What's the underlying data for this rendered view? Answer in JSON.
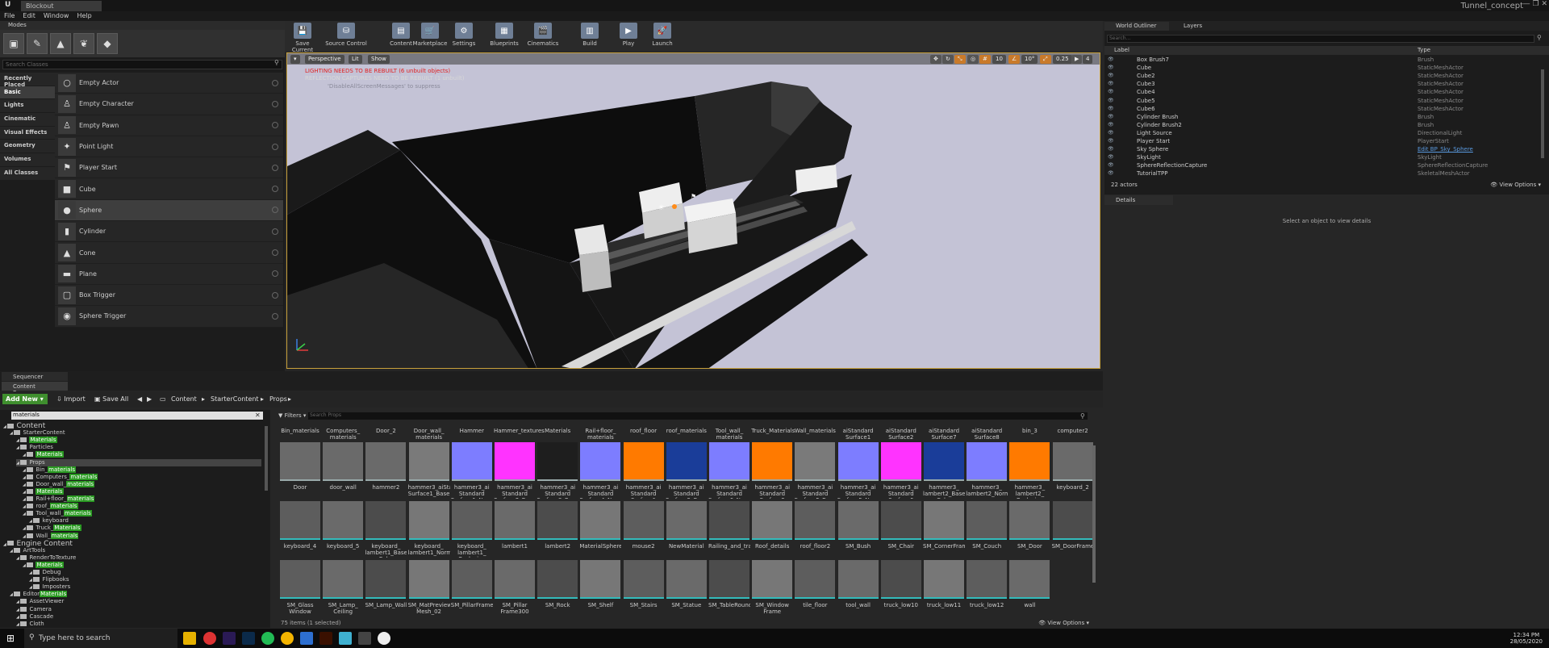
{
  "window": {
    "tab_title": "Blockout",
    "project": "Tunnel_concept",
    "win_controls": "—  ❐  ✕"
  },
  "menu": [
    "File",
    "Edit",
    "Window",
    "Help"
  ],
  "modes": {
    "title": "Modes",
    "search_placeholder": "Search Classes",
    "categories": [
      "Recently Placed",
      "Basic",
      "Lights",
      "Cinematic",
      "Visual Effects",
      "Geometry",
      "Volumes",
      "All Classes"
    ],
    "items": [
      "Empty Actor",
      "Empty Character",
      "Empty Pawn",
      "Point Light",
      "Player Start",
      "Cube",
      "Sphere",
      "Cylinder",
      "Cone",
      "Plane",
      "Box Trigger",
      "Sphere Trigger"
    ]
  },
  "toolbar": [
    "Save Current",
    "Source Control",
    "Content",
    "Marketplace",
    "Settings",
    "Blueprints",
    "Cinematics",
    "Build",
    "Play",
    "Launch"
  ],
  "viewport": {
    "buttons": [
      "Perspective",
      "Lit",
      "Show"
    ],
    "warning1": "LIGHTING NEEDS TO BE REBUILT (6 unbuilt objects)",
    "warning2": "REFLECTION CAPTURES NEED TO BE REBUILT (1 unbuilt)",
    "warning3": "'DisableAllScreenMessages' to suppress",
    "snap_values": [
      "10",
      "10°",
      "0.25",
      "4"
    ]
  },
  "outliner": {
    "tabs": [
      "World Outliner",
      "Layers"
    ],
    "search_placeholder": "Search...",
    "col_label": "Label",
    "col_type": "Type",
    "rows": [
      {
        "label": "Box Brush7",
        "type": "Brush"
      },
      {
        "label": "Cube",
        "type": "StaticMeshActor"
      },
      {
        "label": "Cube2",
        "type": "StaticMeshActor"
      },
      {
        "label": "Cube3",
        "type": "StaticMeshActor"
      },
      {
        "label": "Cube4",
        "type": "StaticMeshActor"
      },
      {
        "label": "Cube5",
        "type": "StaticMeshActor"
      },
      {
        "label": "Cube6",
        "type": "StaticMeshActor"
      },
      {
        "label": "Cylinder Brush",
        "type": "Brush"
      },
      {
        "label": "Cylinder Brush2",
        "type": "Brush"
      },
      {
        "label": "Light Source",
        "type": "DirectionalLight"
      },
      {
        "label": "Player Start",
        "type": "PlayerStart"
      },
      {
        "label": "Sky Sphere",
        "type": "Edit BP_Sky_Sphere"
      },
      {
        "label": "SkyLight",
        "type": "SkyLight"
      },
      {
        "label": "SphereReflectionCapture",
        "type": "SphereReflectionCapture"
      },
      {
        "label": "TutorialTPP",
        "type": "SkeletalMeshActor"
      }
    ],
    "count": "22 actors",
    "view_options": "View Options"
  },
  "details": {
    "tab": "Details",
    "message": "Select an object to view details"
  },
  "bottom_tabs": [
    "Sequencer",
    "Content Browser"
  ],
  "content_browser": {
    "add_new": "Add New",
    "import": "Import",
    "save_all": "Save All",
    "path": [
      "Content",
      "StarterContent",
      "Props"
    ],
    "tree_search": "materials",
    "filters": "Filters",
    "search_placeholder": "Search Props",
    "tree": [
      {
        "label": "Content",
        "hl": "",
        "indent": 0,
        "bold": true
      },
      {
        "label": "StarterContent",
        "hl": "",
        "indent": 1
      },
      {
        "label": "",
        "hl": "Materials",
        "indent": 2
      },
      {
        "label": "Particles",
        "hl": "",
        "indent": 2
      },
      {
        "label": "",
        "hl": "Materials",
        "indent": 3
      },
      {
        "label": "Props",
        "hl": "",
        "indent": 2,
        "sel": true
      },
      {
        "label": "Bin_",
        "hl": "materials",
        "indent": 3
      },
      {
        "label": "Computers_",
        "hl": "materials",
        "indent": 3
      },
      {
        "label": "Door_wall_",
        "hl": "materials",
        "indent": 3
      },
      {
        "label": "",
        "hl": "Materials",
        "indent": 3
      },
      {
        "label": "Rail+floor_",
        "hl": "materials",
        "indent": 3
      },
      {
        "label": "roof_",
        "hl": "materials",
        "indent": 3
      },
      {
        "label": "Tool_wall_",
        "hl": "materials",
        "indent": 3
      },
      {
        "label": "keyboard",
        "hl": "",
        "indent": 4
      },
      {
        "label": "Truck_",
        "hl": "Materials",
        "indent": 3
      },
      {
        "label": "Wall_",
        "hl": "materials",
        "indent": 3
      },
      {
        "label": "Engine Content",
        "hl": "",
        "indent": 0,
        "bold": true
      },
      {
        "label": "ArtTools",
        "hl": "",
        "indent": 1
      },
      {
        "label": "RenderToTexture",
        "hl": "",
        "indent": 2
      },
      {
        "label": "",
        "hl": "Materials",
        "indent": 3
      },
      {
        "label": "Debug",
        "hl": "",
        "indent": 4
      },
      {
        "label": "Flipbooks",
        "hl": "",
        "indent": 4
      },
      {
        "label": "Imposters",
        "hl": "",
        "indent": 4
      },
      {
        "label": "Editor",
        "hl": "Materials",
        "indent": 1
      },
      {
        "label": "AssetViewer",
        "hl": "",
        "indent": 2
      },
      {
        "label": "Camera",
        "hl": "",
        "indent": 2
      },
      {
        "label": "Cascade",
        "hl": "",
        "indent": 2
      },
      {
        "label": "Cloth",
        "hl": "",
        "indent": 2
      }
    ],
    "header_row": [
      "Bin_materials",
      "Computers_ materials",
      "Door_2",
      "Door_wall_ materials",
      "Hammer",
      "Hammer_textures",
      "Materials",
      "Rail+floor_ materials",
      "roof_floor",
      "roof_materials",
      "Tool_wall_ materials",
      "Truck_Materials",
      "Wall_materials",
      "aiStandard Surface1",
      "aiStandard Surface2",
      "aiStandard Surface7",
      "aiStandard Surface8",
      "bin_3",
      "computer2"
    ],
    "row1": [
      {
        "name": "Door",
        "c": "#6a6a6a"
      },
      {
        "name": "door_wall",
        "c": "#6a6a6a"
      },
      {
        "name": "hammer2",
        "c": "#6a6a6a"
      },
      {
        "name": "hammer3_aiStandard Surface1_Base",
        "c": "#7a7a7a"
      },
      {
        "name": "hammer3_ai Standard Surface1_Normal",
        "c": "#7d7dff"
      },
      {
        "name": "hammer3_ai Standard Surface2_Base",
        "c": "#ff33ff"
      },
      {
        "name": "hammer3_ai Standard Surface3_Base",
        "c": "#1e1e1e"
      },
      {
        "name": "hammer3_ai Standard Surface4_Normal",
        "c": "#7d7dff"
      },
      {
        "name": "hammer3_ai Standard Surface1",
        "c": "#ff7a00"
      },
      {
        "name": "hammer3_ai Standard Surface5_Base",
        "c": "#1a3d99"
      },
      {
        "name": "hammer3_ai Standard Surface6_Normal",
        "c": "#7d7dff"
      },
      {
        "name": "hammer3_ai Standard Surface3",
        "c": "#ff7a00"
      },
      {
        "name": "hammer3_ai Standard Surface5_Base",
        "c": "#7a7a7a"
      },
      {
        "name": "hammer3_ai Standard Surface5_Normal",
        "c": "#7d7dff"
      },
      {
        "name": "hammer3_ai Standard Surface6",
        "c": "#ff33ff"
      },
      {
        "name": "hammer3_ lambert2_Base Color",
        "c": "#1a3d99"
      },
      {
        "name": "hammer3_ lambert2_Normal",
        "c": "#7d7dff"
      },
      {
        "name": "hammer3_ lambert2_ Occlusion",
        "c": "#ff7a00"
      },
      {
        "name": "keyboard_2",
        "c": "#6a6a6a"
      }
    ],
    "row2": [
      "keyboard_4",
      "keyboard_5",
      "keyboard_ lambert1_Base Color",
      "keyboard_ lambert1_Normal",
      "keyboard_ lambert1_ Occlusion",
      "lambert1",
      "lambert2",
      "MaterialSphere",
      "mouse2",
      "NewMaterial",
      "Railing_and_trail",
      "Roof_details",
      "roof_floor2",
      "SM_Bush",
      "SM_Chair",
      "SM_CornerFrame",
      "SM_Couch",
      "SM_Door",
      "SM_DoorFrame"
    ],
    "row3": [
      "SM_Glass Window",
      "SM_Lamp_ Ceiling",
      "SM_Lamp_Wall",
      "SM_MatPreview Mesh_02",
      "SM_PillarFrame",
      "SM_Pillar Frame300",
      "SM_Rock",
      "SM_Shelf",
      "SM_Stairs",
      "SM_Statue",
      "SM_TableRound",
      "SM_Window Frame",
      "tile_floor",
      "tool_wall",
      "truck_low10",
      "truck_low11",
      "truck_low12",
      "wall"
    ],
    "footer": "75 items (1 selected)",
    "view_options": "View Options"
  },
  "taskbar": {
    "search": "Type here to search",
    "time": "12:34 PM",
    "date": "28/05/2020"
  }
}
